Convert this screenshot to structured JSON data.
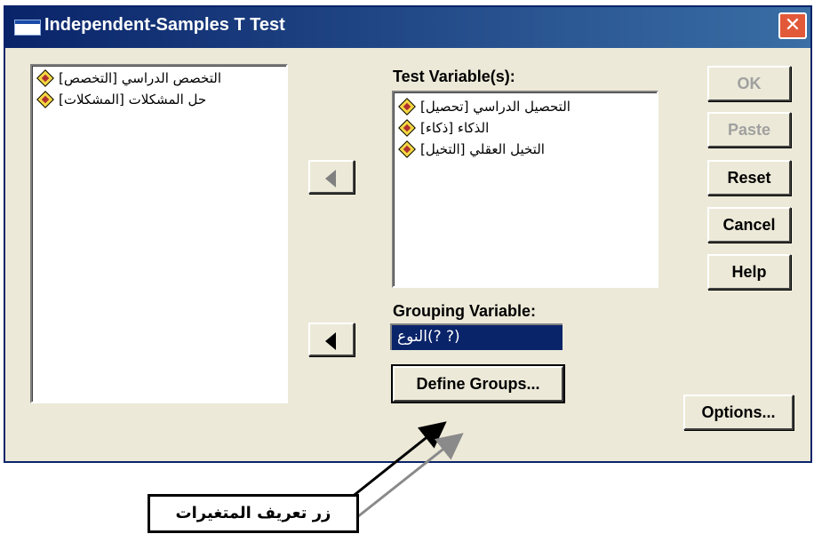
{
  "window": {
    "title": "Independent-Samples T Test",
    "close_glyph": "✕"
  },
  "source_list": {
    "items": [
      {
        "label": "التخصص الدراسي [التخصص]"
      },
      {
        "label": "حل المشكلات [المشكلات]"
      }
    ]
  },
  "test_variables": {
    "label": "Test Variable(s):",
    "items": [
      {
        "label": "التحصيل الدراسي [تحصيل]"
      },
      {
        "label": "الذكاء [ذكاء]"
      },
      {
        "label": "التخيل العقلي [التخيل]"
      }
    ]
  },
  "grouping": {
    "label": "Grouping Variable:",
    "value": "النوع(? ?)"
  },
  "buttons": {
    "ok": "OK",
    "paste": "Paste",
    "reset": "Reset",
    "cancel": "Cancel",
    "help": "Help",
    "define_groups": "Define Groups...",
    "options": "Options..."
  },
  "annotation": {
    "text": "زر تعريف المتغيرات"
  },
  "colors": {
    "title_bar": "#0a246a",
    "dialog_bg": "#ece9d8",
    "selection": "#0a246a",
    "close_button": "#e2593a"
  }
}
